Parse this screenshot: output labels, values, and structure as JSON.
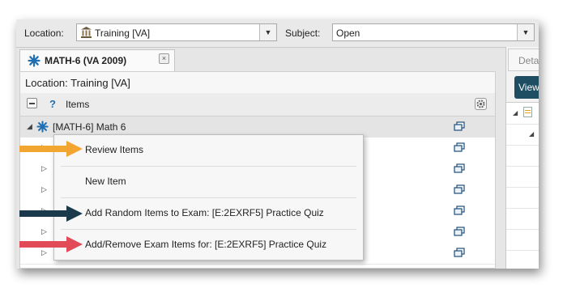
{
  "toolbar": {
    "location_label": "Location:",
    "location_value": "Training [VA]",
    "subject_label": "Subject:",
    "subject_value": "Open"
  },
  "tab": {
    "label": "MATH-6 (VA 2009)"
  },
  "left_pane": {
    "location_text": "Location: Training [VA]",
    "items_header": "Items",
    "help_symbol": "?",
    "tree_root": "[MATH-6] Math 6"
  },
  "right_pane": {
    "tab_label": "Deta",
    "view_button": "View"
  },
  "context_menu": {
    "items": [
      {
        "label": "Review Items"
      },
      {
        "label": "New Item"
      },
      {
        "label": "Add Random Items to Exam: [E:2EXRF5] Practice Quiz"
      },
      {
        "label": "Add/Remove Exam Items for: [E:2EXRF5] Practice Quiz"
      }
    ]
  },
  "annotations": {
    "arrow_colors": [
      "#f2a530",
      "#1b3a4b",
      "#e34a57"
    ]
  },
  "colors": {
    "accent_blue": "#1f6fb2",
    "view_button_bg": "#1f4e63"
  }
}
